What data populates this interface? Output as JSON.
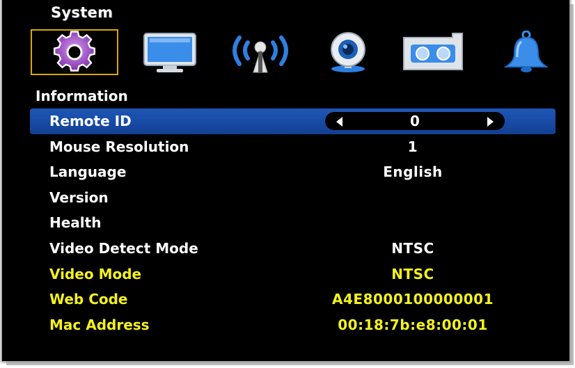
{
  "menu": {
    "title": "System"
  },
  "toolbar": {
    "icons": [
      {
        "name": "gear-icon",
        "selected": true
      },
      {
        "name": "monitor-icon",
        "selected": false
      },
      {
        "name": "network-antenna-icon",
        "selected": false
      },
      {
        "name": "webcam-icon",
        "selected": false
      },
      {
        "name": "storage-tape-icon",
        "selected": false
      },
      {
        "name": "bell-icon",
        "selected": false
      }
    ]
  },
  "section": {
    "title": "Information"
  },
  "rows": [
    {
      "label": "Remote ID",
      "value": "0",
      "highlighted": true
    },
    {
      "label": "Mouse Resolution",
      "value": "1"
    },
    {
      "label": "Language",
      "value": "English"
    },
    {
      "label": "Version",
      "value": ""
    },
    {
      "label": "Health",
      "value": ""
    },
    {
      "label": "Video Detect Mode",
      "value": "NTSC"
    },
    {
      "label": "Video Mode",
      "value": "NTSC",
      "color": "#f4f21a"
    },
    {
      "label": "Web Code",
      "value": "A4E8000100000001",
      "color": "#f4f21a"
    },
    {
      "label": "Mac Address",
      "value": "00:18:7b:e8:00:01",
      "color": "#f4f21a"
    }
  ],
  "colors": {
    "highlight": "#1e57b8",
    "selection_border": "#d9a800",
    "yellow_text": "#f4f21a",
    "icon_purple": "#9b3fc7",
    "icon_blue": "#3d8be8"
  }
}
